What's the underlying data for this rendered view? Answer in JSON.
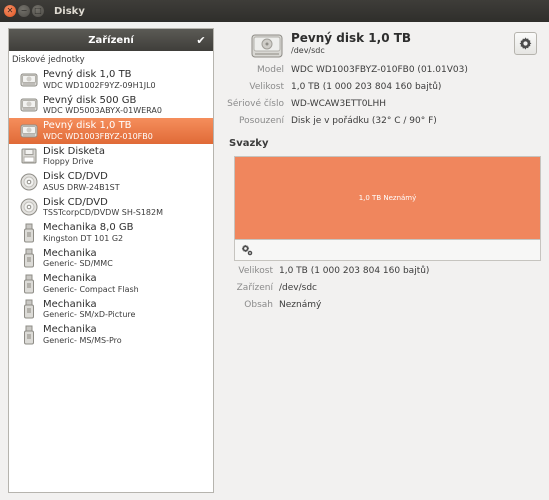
{
  "window": {
    "title": "Disky"
  },
  "sidebar": {
    "header": "Zařízení",
    "section": "Diskové jednotky",
    "items": [
      {
        "name": "Pevný disk 1,0 TB",
        "sub": "WDC WD1002F9YZ-09H1JL0",
        "icon": "hdd-icon"
      },
      {
        "name": "Pevný disk 500 GB",
        "sub": "WDC WD5003ABYX-01WERA0",
        "icon": "hdd-icon"
      },
      {
        "name": "Pevný disk 1,0 TB",
        "sub": "WDC WD1003FBYZ-010FB0",
        "icon": "hdd-icon",
        "selected": true
      },
      {
        "name": "Disk Disketa",
        "sub": "Floppy Drive",
        "icon": "floppy-icon"
      },
      {
        "name": "Disk CD/DVD",
        "sub": "ASUS    DRW-24B1ST",
        "icon": "optical-disc-icon"
      },
      {
        "name": "Disk CD/DVD",
        "sub": "TSSTcorpCD/DVDW SH-S182M",
        "icon": "optical-disc-icon"
      },
      {
        "name": "Mechanika 8,0 GB",
        "sub": "Kingston DT 101 G2",
        "icon": "usb-drive-icon"
      },
      {
        "name": "Mechanika",
        "sub": "Generic- SD/MMC",
        "icon": "usb-drive-icon"
      },
      {
        "name": "Mechanika",
        "sub": "Generic- Compact Flash",
        "icon": "usb-drive-icon"
      },
      {
        "name": "Mechanika",
        "sub": "Generic- SM/xD-Picture",
        "icon": "usb-drive-icon"
      },
      {
        "name": "Mechanika",
        "sub": "Generic- MS/MS-Pro",
        "icon": "usb-drive-icon"
      }
    ]
  },
  "drive": {
    "title": "Pevný disk 1,0 TB",
    "device": "/dev/sdc",
    "props": [
      {
        "label": "Model",
        "value": "WDC WD1003FBYZ-010FB0 (01.01V03)"
      },
      {
        "label": "Velikost",
        "value": "1,0 TB (1 000 203 804 160 bajtů)"
      },
      {
        "label": "Sériové číslo",
        "value": "WD-WCAW3ETT0LHH"
      },
      {
        "label": "Posouzení",
        "value": "Disk je v pořádku (32° C / 90° F)"
      }
    ]
  },
  "volumes": {
    "heading": "Svazky",
    "partition_label": "1,0 TB Neznámý",
    "partition_color": "#f0865d",
    "props": [
      {
        "label": "Velikost",
        "value": "1,0 TB (1 000 203 804 160 bajtů)"
      },
      {
        "label": "Zařízení",
        "value": "/dev/sdc"
      },
      {
        "label": "Obsah",
        "value": "Neznámý"
      }
    ]
  },
  "colors": {
    "selection": "#e8703c",
    "titlebar": "#3a3935",
    "sidebar_header": "#4a4945"
  }
}
